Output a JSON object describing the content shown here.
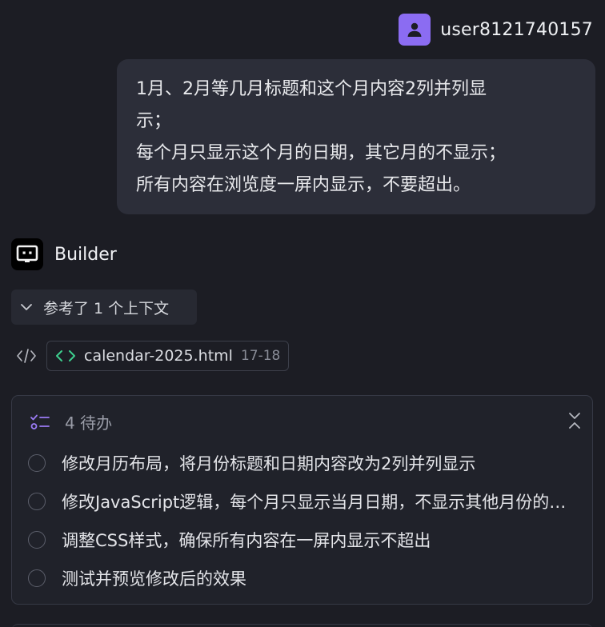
{
  "user": {
    "name": "user8121740157",
    "avatar_icon": "person-icon",
    "avatar_color": "#8b6cf2"
  },
  "message": {
    "lines": [
      "1月、2月等几月标题和这个月内容2列并列显",
      "示；",
      "每个月只显示这个月的日期，其它月的不显示；",
      "所有内容在浏览度一屏内显示，不要超出。"
    ]
  },
  "assistant": {
    "name": "Builder",
    "logo_icon": "builder-logo-icon"
  },
  "context": {
    "label": "参考了 1 个上下文",
    "icon": "chevron-down-icon"
  },
  "file_ref": {
    "icon": "code-icon",
    "name": "calendar-2025.html",
    "range": "17-18"
  },
  "todos": {
    "title": "4 待办",
    "items": [
      {
        "text": "修改月历布局，将月份标题和日期内容改为2列并列显示",
        "done": false
      },
      {
        "text": "修改JavaScript逻辑，每个月只显示当月日期，不显示其他月份的日期",
        "done": false
      },
      {
        "text": "调整CSS样式，确保所有内容在一屏内显示不超出",
        "done": false
      },
      {
        "text": "测试并预览修改后的效果",
        "done": false
      }
    ]
  }
}
